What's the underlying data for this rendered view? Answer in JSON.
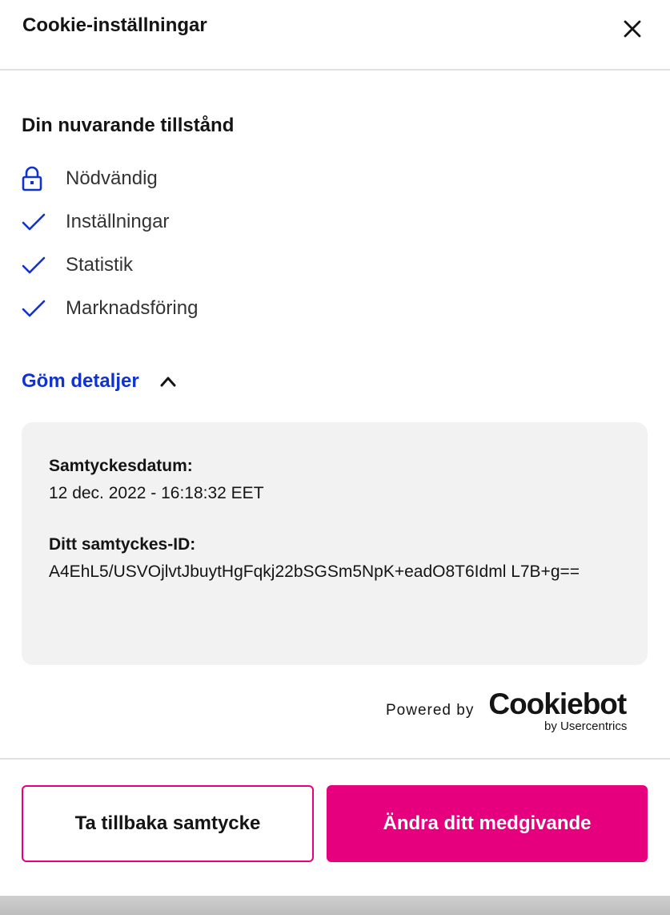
{
  "header": {
    "title": "Cookie-inställningar",
    "close_icon": "close-icon"
  },
  "state": {
    "title": "Din nuvarande tillstånd",
    "items": [
      {
        "label": "Nödvändig",
        "icon": "lock-icon"
      },
      {
        "label": "Inställningar",
        "icon": "check-icon"
      },
      {
        "label": "Statistik",
        "icon": "check-icon"
      },
      {
        "label": "Marknadsföring",
        "icon": "check-icon"
      }
    ]
  },
  "details": {
    "toggle_label": "Göm detaljer",
    "toggle_icon": "chevron-up-icon",
    "date_label": "Samtyckesdatum:",
    "date_value": "12 dec. 2022 - 16:18:32 EET",
    "id_label": "Ditt samtyckes-ID:",
    "id_value": "A4EhL5/USVOjlvtJbuytHgFqkj22bSGSm5NpK+eadO8T6Idml L7B+g=="
  },
  "powered": {
    "by": "Powered by",
    "brand": "Cookiebot",
    "brand_sub": "by Usercentrics"
  },
  "buttons": {
    "withdraw": "Ta tillbaka samtycke",
    "change": "Ändra ditt medgivande"
  },
  "colors": {
    "accent": "#e6007e",
    "link": "#1032cf",
    "icon": "#1032cf"
  }
}
